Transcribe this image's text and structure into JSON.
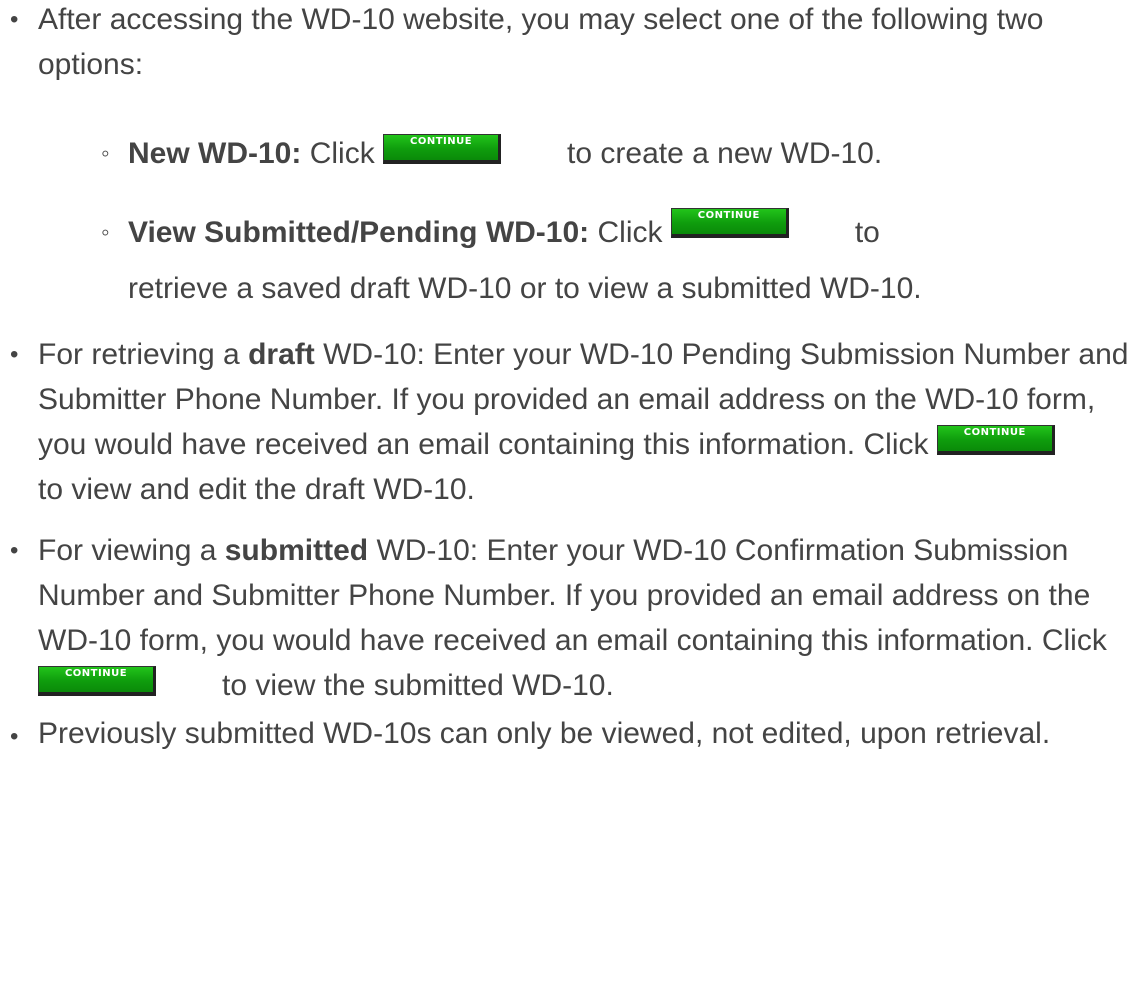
{
  "button_label": "CONTINUE",
  "intro": {
    "text": "After accessing the WD-10 website, you may select one of the following two options:"
  },
  "options": [
    {
      "label": "New WD-10:",
      "pre": "Click",
      "post": "to create a new WD-10."
    },
    {
      "label": "View Submitted/Pending WD-10:",
      "pre": "Click",
      "post_line1": "to",
      "post_line2": "retrieve a saved draft WD-10 or to view a submitted WD-10."
    }
  ],
  "draft": {
    "prefix": "For retrieving a",
    "bold": "draft",
    "text": "WD-10: Enter your WD-10 Pending Submission Number and Submitter Phone Number. If you provided an email address on the WD-10 form, you would have received an email containing this information.",
    "pre": "Click",
    "post": "to view and edit the draft WD-10."
  },
  "submitted": {
    "prefix": "For viewing a",
    "bold": "submitted",
    "text": "WD-10: Enter your WD-10 Confirmation Submission Number and Submitter Phone Number. If you provided an email address on the WD-10 form, you would have received an email containing this information.",
    "pre": "Click",
    "post": "to view the submitted WD-10."
  },
  "note": {
    "text": "Previously submitted WD-10s can only be viewed, not edited, upon retrieval."
  }
}
